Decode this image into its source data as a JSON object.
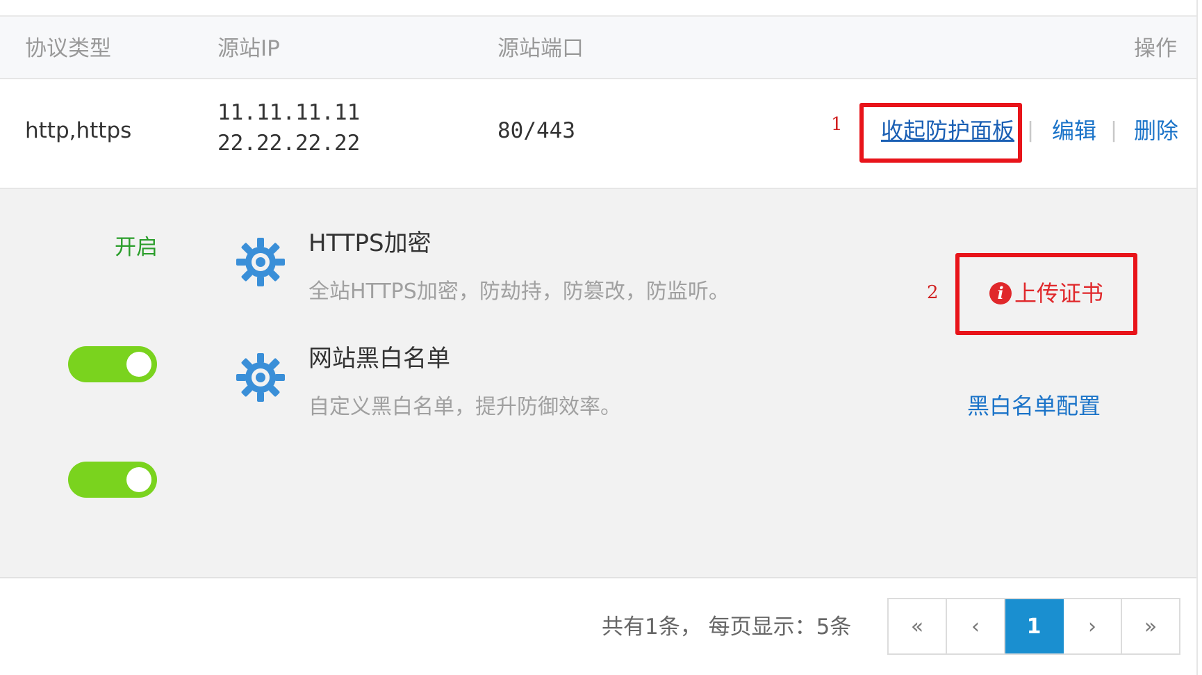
{
  "table": {
    "headers": {
      "protocol": "协议类型",
      "source_ip": "源站IP",
      "source_port": "源站端口",
      "actions": "操作"
    },
    "row": {
      "protocol": "http,https",
      "ips": [
        "11.11.11.11",
        "22.22.22.22"
      ],
      "port": "80/443",
      "actions": {
        "collapse": "收起防护面板",
        "edit": "编辑",
        "delete": "删除",
        "separator": "|"
      }
    }
  },
  "annotations": {
    "marker1": "1",
    "marker2": "2",
    "box_color": "#e8141a"
  },
  "panel": {
    "status_label": "开启",
    "features": [
      {
        "icon": "gear-icon",
        "title": "HTTPS加密",
        "description": "全站HTTPS加密，防劫持，防篡改，防监听。",
        "action": "上传证书",
        "action_icon": "info-icon",
        "toggle_on": true
      },
      {
        "icon": "gear-icon",
        "title": "网站黑白名单",
        "description": "自定义黑白名单，提升防御效率。",
        "action": "黑白名单配置",
        "toggle_on": true
      }
    ],
    "toggle_color": "#7ad31e"
  },
  "pagination": {
    "summary": "共有1条， 每页显示：5条",
    "first": "«",
    "prev": "‹",
    "current": "1",
    "next": "›",
    "last": "»",
    "active_color": "#1a8fd0"
  },
  "colors": {
    "link": "#1a73c8",
    "danger": "#e0282b",
    "status_on": "#2b9e2b"
  }
}
